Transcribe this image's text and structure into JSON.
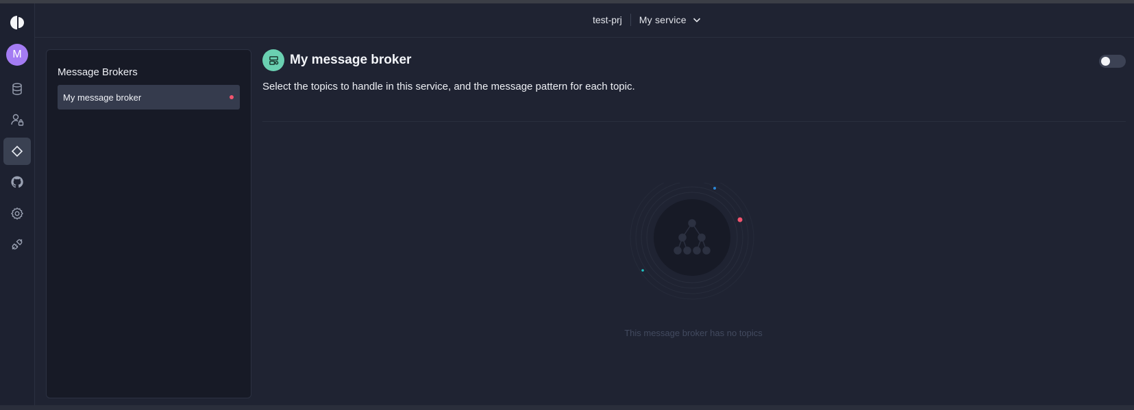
{
  "header": {
    "project": "test-prj",
    "service": "My service"
  },
  "rail": {
    "avatar_initial": "M",
    "items": [
      {
        "icon": "database-icon"
      },
      {
        "icon": "user-lock-icon"
      },
      {
        "icon": "diamond-icon",
        "active": true
      },
      {
        "icon": "github-icon"
      },
      {
        "icon": "gear-icon"
      },
      {
        "icon": "plug-icon"
      }
    ]
  },
  "sidebar": {
    "title": "Message Brokers",
    "items": [
      {
        "label": "My message broker",
        "status_color": "#f2546e",
        "selected": true
      }
    ]
  },
  "main": {
    "title": "My message broker",
    "description": "Select the topics to handle in this service, and the message pattern for each topic.",
    "empty_state": "This message broker has no topics",
    "toggle_on": false
  },
  "colors": {
    "accent_green": "#6ad0b1",
    "status_red": "#f2546e",
    "avatar_purple": "#a47cf3",
    "background": "#1f2332"
  }
}
